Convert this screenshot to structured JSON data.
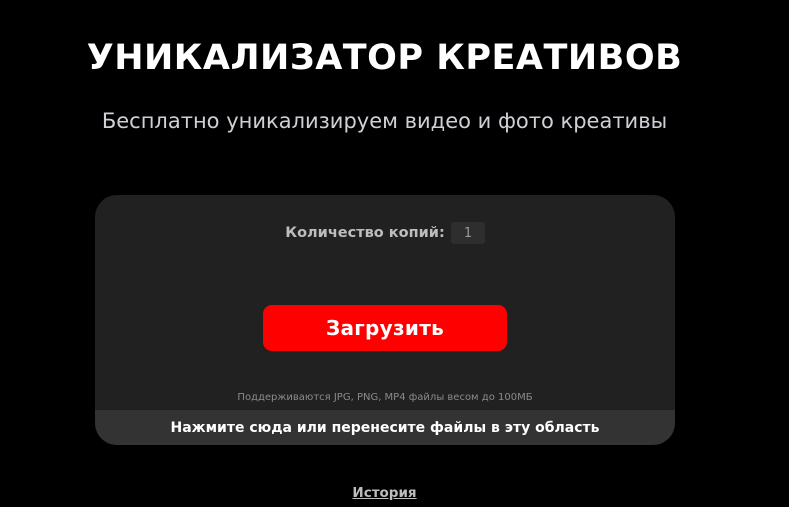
{
  "header": {
    "title": "УНИКАЛИЗАТОР КРЕАТИВОВ",
    "subtitle": "Бесплатно уникализируем видео и фото креативы"
  },
  "uploader": {
    "copies_label": "Количество копий:",
    "copies_value": "1",
    "upload_button_label": "Загрузить",
    "supported_formats_text": "Поддерживаются JPG, PNG, MP4 файлы весом до 100МБ",
    "drop_zone_text": "Нажмите сюда или перенесите файлы в эту область"
  },
  "footer": {
    "history_link": "История"
  },
  "colors": {
    "background": "#000000",
    "card": "#212121",
    "accent": "#ff0000",
    "drop_bar": "#333333"
  }
}
